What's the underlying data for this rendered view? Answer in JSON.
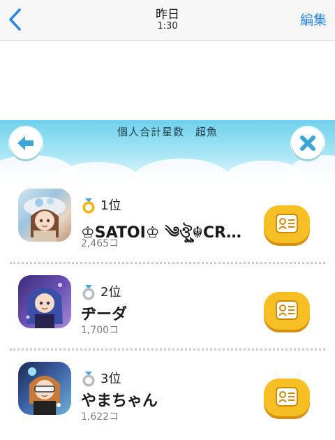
{
  "nav": {
    "title": "昨日",
    "subtitle": "1:30",
    "edit_label": "編集"
  },
  "panel": {
    "title": "個人合計星数　超魚"
  },
  "rankings": [
    {
      "rank": "1位",
      "name": "♔SATOI♔ ༄ঔৣ☬CR…",
      "stars": "2,465コ",
      "medal": "gold"
    },
    {
      "rank": "2位",
      "name": "ヂーダ",
      "stars": "1,700コ",
      "medal": "silver"
    },
    {
      "rank": "3位",
      "name": "やまちゃん",
      "stars": "1,622コ",
      "medal": "silver"
    }
  ],
  "colors": {
    "accent_blue": "#2a84e0",
    "profile_button": "#f6bf23",
    "panel_sky": "#6fd2ec"
  }
}
